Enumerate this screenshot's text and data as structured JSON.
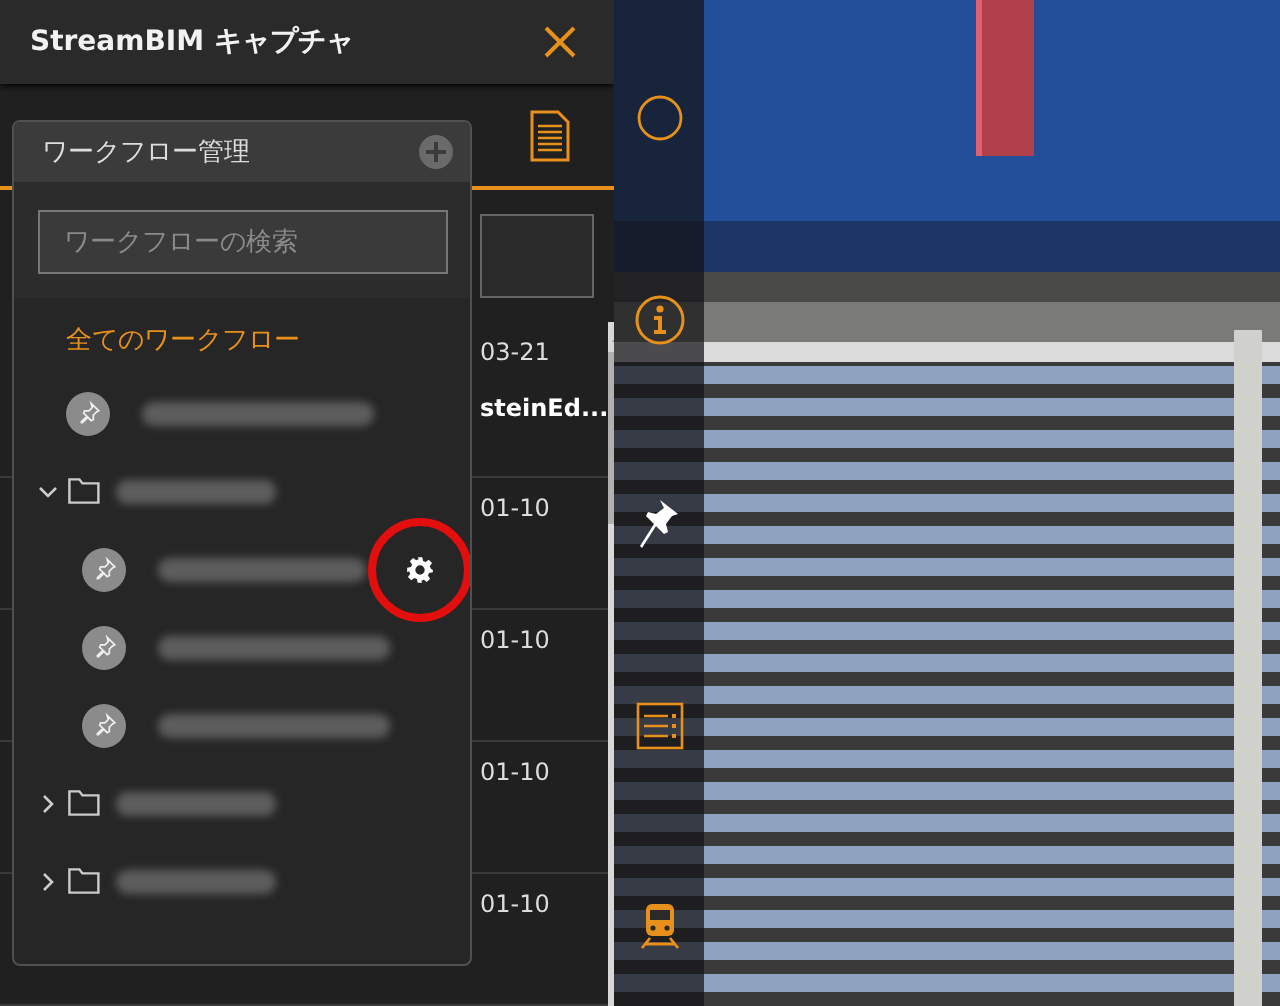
{
  "header": {
    "title": "StreamBIM キャプチャ"
  },
  "background_list": {
    "rows": [
      {
        "date": "03-21",
        "subtitle": "steinEd..."
      },
      {
        "date": "01-10"
      },
      {
        "date": "01-10"
      },
      {
        "date": "01-10"
      },
      {
        "date": "01-10"
      }
    ]
  },
  "workflow_panel": {
    "title": "ワークフロー管理",
    "search": {
      "placeholder": "ワークフローの検索"
    },
    "all_item": {
      "label": "全てのワークフロー",
      "selected": true
    },
    "tree": [
      {
        "kind": "workflow",
        "selected": false,
        "settings_shown": false
      },
      {
        "kind": "folder",
        "selected": false,
        "expanded": true,
        "children": [
          {
            "kind": "workflow",
            "selected": false,
            "settings_shown": true
          },
          {
            "kind": "workflow",
            "selected": false,
            "settings_shown": false
          },
          {
            "kind": "workflow",
            "selected": false,
            "settings_shown": false
          }
        ]
      },
      {
        "kind": "folder",
        "selected": false,
        "expanded": false
      },
      {
        "kind": "folder",
        "selected": false,
        "expanded": false
      }
    ]
  }
}
